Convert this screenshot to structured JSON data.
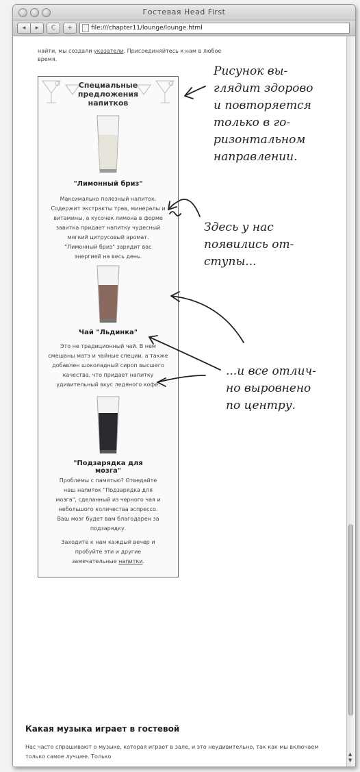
{
  "window": {
    "title": "Гостевая Head First"
  },
  "toolbar": {
    "back": "◂",
    "forward": "▸",
    "reload": "C",
    "add": "+",
    "url": "file:///chapter11/lounge/lounge.html"
  },
  "page": {
    "intro_line1": "найти, мы создали",
    "intro_link": "указатели",
    "intro_line1b": ". Присоединяйтесь к нам в любое",
    "intro_line2": "время.",
    "sidebar_title": "Специальные предложения напитков",
    "drinks": [
      {
        "name": "\"Лимонный бриз\"",
        "text": "Максимально полезный напиток. Содержит экстракты трав, минералы и витамины, а кусочек лимона в форме завитка придает напитку чудесный мягкий цитрусовый аромат. \"Лимонный бриз\" зарядит вас энергией на весь день.",
        "color": "#e6e4d8"
      },
      {
        "name": "Чай \"Льдинка\"",
        "text": "Это не традиционный чай. В нем смешаны матэ и чайные специи, а также добавлен шоколадный сироп высшего качества, что придает напитку удивительный вкус ледяного кофе.",
        "color": "#8a6a5e"
      },
      {
        "name": "\"Подзарядка для мозга\"",
        "text": "Проблемы с памятью? Отведайте наш напиток \"Подзарядка для мозга\", сделанный из черного чая и небольшого количества эспрессо. Ваш мозг будет вам благодарен за подзарядку.",
        "color": "#2a2a2e"
      }
    ],
    "footer_text": "Заходите к нам каждый вечер и пробуйте эти и другие замечательные",
    "footer_link": "напитки",
    "footer_end": ".",
    "section_title": "Какая музыка играет в гостевой",
    "section_text": "Нас часто спрашивают о музыке, которая играет в зале, и это неудивительно, так как мы включаем только самое лучшее. Только"
  },
  "annotations": {
    "note1": "Рисунок вы-\nглядит здорово\nи повторяется\nтолько в го-\nризонтальном\nнаправлении.",
    "note2": "Здесь у нас\nпоявились от-\nступы...",
    "note3": "...и все отлич-\nно выровнено\nпо центру."
  }
}
